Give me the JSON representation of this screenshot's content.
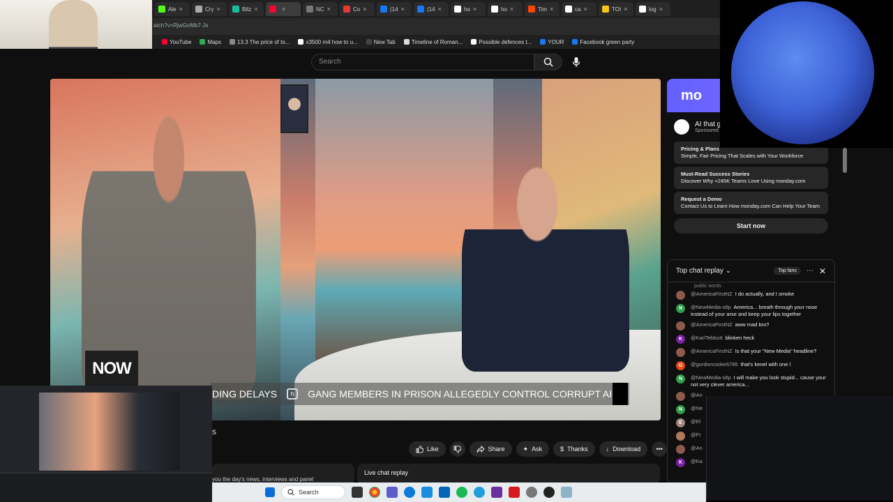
{
  "browser": {
    "url": "atch?v=RjwGoMb7-Js",
    "tabs": [
      {
        "label": "Ale",
        "icon": "kick-icon",
        "color": "#53fc18"
      },
      {
        "label": "Cry",
        "icon": "crypto-icon",
        "color": "#aaaaaa"
      },
      {
        "label": "Bitz",
        "icon": "bitz-icon",
        "color": "#1abc9c"
      },
      {
        "label": "",
        "icon": "youtube-icon",
        "color": "#ff0033",
        "active": true
      },
      {
        "label": "NC",
        "icon": "generic-icon",
        "color": "#777777"
      },
      {
        "label": "Co",
        "icon": "generic-icon",
        "color": "#e53935"
      },
      {
        "label": "(14",
        "icon": "facebook-icon",
        "color": "#1877f2"
      },
      {
        "label": "(14",
        "icon": "facebook-icon",
        "color": "#1877f2"
      },
      {
        "label": "ho",
        "icon": "google-icon",
        "color": "#ffffff"
      },
      {
        "label": "ho",
        "icon": "google-icon",
        "color": "#ffffff"
      },
      {
        "label": "Tim",
        "icon": "reddit-icon",
        "color": "#ff4500"
      },
      {
        "label": "ca",
        "icon": "google-icon",
        "color": "#ffffff"
      },
      {
        "label": "TOI",
        "icon": "toi-icon",
        "color": "#f5c518"
      },
      {
        "label": "log",
        "icon": "google-icon",
        "color": "#ffffff"
      }
    ],
    "bookmarks": [
      {
        "label": "YouTube",
        "color": "#ff0033"
      },
      {
        "label": "Maps",
        "color": "#34a853"
      },
      {
        "label": "13.3 The price of to...",
        "color": "#888888"
      },
      {
        "label": "x3500 m4 how to u...",
        "color": "#ffffff"
      },
      {
        "label": "New Tab",
        "color": "#444444"
      },
      {
        "label": "Timeline of Roman...",
        "color": "#dddddd"
      },
      {
        "label": "Possible defences t...",
        "color": "#ffffff"
      },
      {
        "label": "YOUR",
        "color": "#1877f2"
      },
      {
        "label": "Facebook green party",
        "color": "#1877f2"
      }
    ]
  },
  "youtube": {
    "search_placeholder": "Search",
    "video": {
      "now_logo": "NOW",
      "ticker_left": "DING DELAYS",
      "ticker_right": "GANG MEMBERS IN PRISON ALLEGEDLY CONTROL CORRUPT AIRP"
    },
    "title_fragment": "s",
    "actions": {
      "like": "Like",
      "share": "Share",
      "ask": "Ask",
      "thanks": "Thanks",
      "download": "Download"
    },
    "description_fragment": "you the day's news, interviews and panel",
    "live_chat_replay": "Live chat replay"
  },
  "ad": {
    "brand": "mo",
    "title": "AI that g",
    "sponsored": "Sponsored",
    "links": [
      {
        "title": "Pricing & Plans",
        "text": "Simple, Fair Pricing That Scales with Your Workforce"
      },
      {
        "title": "Must-Read Success Stories",
        "text": "Discover Why +245K Teams Love Using monday.com"
      },
      {
        "title": "Request a Demo",
        "text": "Contact Us to Learn How monday.com Can Help Your Team"
      }
    ],
    "cta": "Start now"
  },
  "chat": {
    "header": "Top chat replay",
    "top_fans": "Top fans",
    "partial_top": "public words",
    "messages": [
      {
        "user": "@AmericaFirstNZ",
        "text": "I do actually, and I smoke",
        "initial": "",
        "color": "#8d5b4c"
      },
      {
        "user": "@NewMedia-s8p",
        "text": "America... breath through your nose instead of your arse and keep your lips together",
        "initial": "N",
        "color": "#2e9e4a"
      },
      {
        "user": "@AmericaFirstNZ",
        "text": "aww mad bro?",
        "initial": "",
        "color": "#8d5b4c"
      },
      {
        "user": "@KarlTebbutt",
        "text": "blinken heck",
        "initial": "K",
        "color": "#7b1fa2"
      },
      {
        "user": "@AmericaFirstNZ",
        "text": "Is that your \"New Media\" headline?",
        "initial": "",
        "color": "#8d5b4c"
      },
      {
        "user": "@gordoncooke6785",
        "text": "that's kenel with one l",
        "initial": "G",
        "color": "#e64a19"
      },
      {
        "user": "@NewMedia-s8p",
        "text": "I will make you look stupid... cause your not very clever america...",
        "initial": "N",
        "color": "#2e9e4a"
      },
      {
        "user": "@An",
        "text": "",
        "initial": "",
        "color": "#8d5b4c"
      },
      {
        "user": "@Ne",
        "text": "",
        "initial": "N",
        "color": "#2e9e4a"
      },
      {
        "user": "@El",
        "text": "",
        "initial": "E",
        "color": "#a1887f"
      },
      {
        "user": "@Fr",
        "text": "",
        "initial": "",
        "color": "#b07a5a"
      },
      {
        "user": "@An",
        "text": "",
        "initial": "",
        "color": "#8d5b4c"
      },
      {
        "user": "@Ka",
        "text": "",
        "initial": "K",
        "color": "#7b1fa2"
      }
    ]
  },
  "taskbar": {
    "search": "Search"
  }
}
